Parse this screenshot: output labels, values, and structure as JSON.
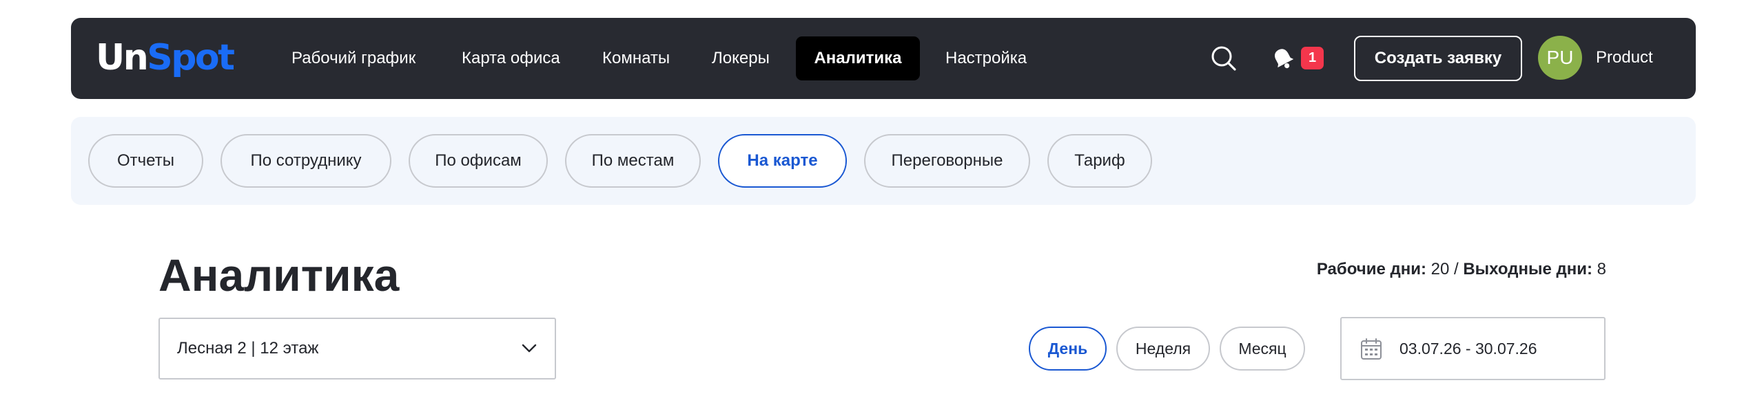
{
  "header": {
    "logo_part1": "Un",
    "logo_part2": "Spot",
    "nav": [
      {
        "label": "Рабочий график"
      },
      {
        "label": "Карта офиса"
      },
      {
        "label": "Комнаты"
      },
      {
        "label": "Локеры"
      },
      {
        "label": "Аналитика",
        "active": true
      },
      {
        "label": "Настройка"
      }
    ],
    "search_icon": "search-icon",
    "bell_icon": "bell-icon",
    "notification_count": "1",
    "create_button": "Создать заявку",
    "avatar_initials": "PU",
    "user_name": "Product"
  },
  "subnav": {
    "tabs": [
      {
        "label": "Отчеты"
      },
      {
        "label": "По сотруднику"
      },
      {
        "label": "По офисам"
      },
      {
        "label": "По местам"
      },
      {
        "label": "На карте",
        "active": true
      },
      {
        "label": "Переговорные"
      },
      {
        "label": "Тариф"
      }
    ]
  },
  "main": {
    "title": "Аналитика",
    "workdays_label": "Рабочие дни:",
    "workdays_value": "20",
    "separator": "/",
    "weekends_label": "Выходные дни:",
    "weekends_value": "8",
    "floor_select_value": "Лесная 2 | 12 этаж",
    "period_options": [
      {
        "label": "День",
        "active": true
      },
      {
        "label": "Неделя"
      },
      {
        "label": "Месяц"
      }
    ],
    "date_range": "03.07.26 - 30.07.26"
  },
  "colors": {
    "topbar_bg": "#282a31",
    "accent_blue": "#1a58d2",
    "logo_blue": "#1a6cf6",
    "badge_red": "#f4364c",
    "avatar_green": "#8bb14a",
    "subbar_bg": "#f2f6fc"
  }
}
